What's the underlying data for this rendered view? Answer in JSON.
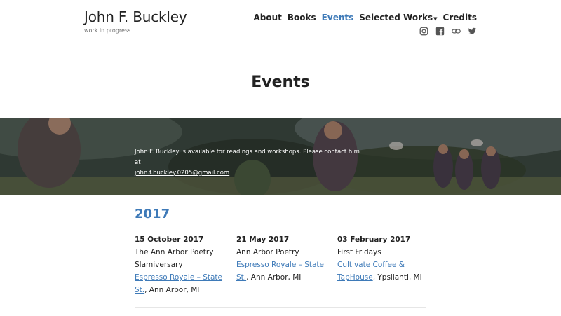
{
  "site": {
    "title": "John F. Buckley",
    "tagline": "work in progress"
  },
  "nav": {
    "items": [
      {
        "label": "About",
        "active": false
      },
      {
        "label": "Books",
        "active": false
      },
      {
        "label": "Events",
        "active": true
      },
      {
        "label": "Selected Works",
        "active": false,
        "has_dropdown": true
      },
      {
        "label": "Credits",
        "active": false
      }
    ]
  },
  "social": [
    "instagram-icon",
    "facebook-icon",
    "link-icon",
    "twitter-icon"
  ],
  "page": {
    "title": "Events"
  },
  "hero": {
    "text": "John F. Buckley is available for readings and workshops. Please contact him at",
    "email": "john.f.buckley.0205@gmail.com"
  },
  "year": "2017",
  "events": [
    {
      "date": "15 October 2017",
      "title": "The Ann Arbor Poetry Slamiversary",
      "venue": "Espresso Royale – State St.",
      "location": ", Ann Arbor, MI"
    },
    {
      "date": "21 May 2017",
      "title": "Ann Arbor Poetry",
      "venue": "Espresso Royale – State St.",
      "location": ", Ann Arbor, MI"
    },
    {
      "date": "03 February 2017",
      "title": "First Fridays",
      "venue": "Cultivate Coffee & TapHouse",
      "location": ", Ypsilanti, MI"
    }
  ],
  "colors": {
    "accent": "#3e7ab8",
    "text": "#222222"
  }
}
